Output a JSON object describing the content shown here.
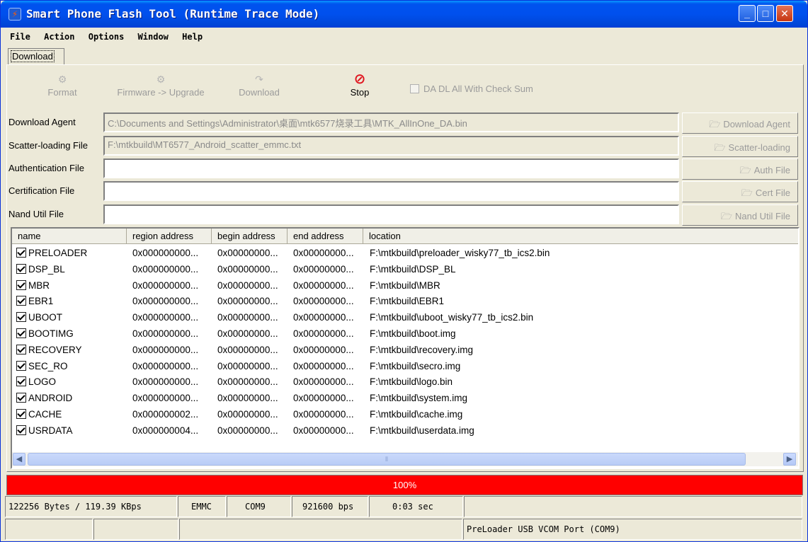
{
  "window": {
    "title": "Smart Phone Flash Tool (Runtime Trace Mode)",
    "icon": "flash-tool-app-icon",
    "controls": [
      "minimize",
      "maximize",
      "close"
    ]
  },
  "menu": [
    {
      "label": "File"
    },
    {
      "label": "Action"
    },
    {
      "label": "Options"
    },
    {
      "label": "Window"
    },
    {
      "label": "Help"
    }
  ],
  "tab": {
    "label": "Download"
  },
  "toolbar": {
    "format": "Format",
    "firmware_upgrade": "Firmware -> Upgrade",
    "download": "Download",
    "stop": "Stop",
    "checksum": "DA DL All With Check Sum"
  },
  "files": [
    {
      "label": "Download Agent",
      "value": "C:\\Documents and Settings\\Administrator\\桌面\\mtk6577烧录工具\\MTK_AllInOne_DA.bin",
      "button": "Download Agent",
      "disabled": true
    },
    {
      "label": "Scatter-loading File",
      "value": "F:\\mtkbuild\\MT6577_Android_scatter_emmc.txt",
      "button": "Scatter-loading",
      "disabled": true
    },
    {
      "label": "Authentication File",
      "value": "",
      "button": "Auth File",
      "disabled": false
    },
    {
      "label": "Certification File",
      "value": "",
      "button": "Cert File",
      "disabled": false
    },
    {
      "label": "Nand Util File",
      "value": "",
      "button": "Nand Util File",
      "disabled": false
    }
  ],
  "table": {
    "columns": [
      "name",
      "region address",
      "begin address",
      "end address",
      "location"
    ],
    "rows": [
      {
        "checked": true,
        "name": "PRELOADER",
        "region": "0x000000000...",
        "begin": "0x00000000...",
        "end": "0x00000000...",
        "location": "F:\\mtkbuild\\preloader_wisky77_tb_ics2.bin"
      },
      {
        "checked": true,
        "name": "DSP_BL",
        "region": "0x000000000...",
        "begin": "0x00000000...",
        "end": "0x00000000...",
        "location": "F:\\mtkbuild\\DSP_BL"
      },
      {
        "checked": true,
        "name": "MBR",
        "region": "0x000000000...",
        "begin": "0x00000000...",
        "end": "0x00000000...",
        "location": "F:\\mtkbuild\\MBR"
      },
      {
        "checked": true,
        "name": "EBR1",
        "region": "0x000000000...",
        "begin": "0x00000000...",
        "end": "0x00000000...",
        "location": "F:\\mtkbuild\\EBR1"
      },
      {
        "checked": true,
        "name": "UBOOT",
        "region": "0x000000000...",
        "begin": "0x00000000...",
        "end": "0x00000000...",
        "location": "F:\\mtkbuild\\uboot_wisky77_tb_ics2.bin"
      },
      {
        "checked": true,
        "name": "BOOTIMG",
        "region": "0x000000000...",
        "begin": "0x00000000...",
        "end": "0x00000000...",
        "location": "F:\\mtkbuild\\boot.img"
      },
      {
        "checked": true,
        "name": "RECOVERY",
        "region": "0x000000000...",
        "begin": "0x00000000...",
        "end": "0x00000000...",
        "location": "F:\\mtkbuild\\recovery.img"
      },
      {
        "checked": true,
        "name": "SEC_RO",
        "region": "0x000000000...",
        "begin": "0x00000000...",
        "end": "0x00000000...",
        "location": "F:\\mtkbuild\\secro.img"
      },
      {
        "checked": true,
        "name": "LOGO",
        "region": "0x000000000...",
        "begin": "0x00000000...",
        "end": "0x00000000...",
        "location": "F:\\mtkbuild\\logo.bin"
      },
      {
        "checked": true,
        "name": "ANDROID",
        "region": "0x000000000...",
        "begin": "0x00000000...",
        "end": "0x00000000...",
        "location": "F:\\mtkbuild\\system.img"
      },
      {
        "checked": true,
        "name": "CACHE",
        "region": "0x000000002...",
        "begin": "0x00000000...",
        "end": "0x00000000...",
        "location": "F:\\mtkbuild\\cache.img"
      },
      {
        "checked": true,
        "name": "USRDATA",
        "region": "0x000000004...",
        "begin": "0x00000000...",
        "end": "0x00000000...",
        "location": "F:\\mtkbuild\\userdata.img"
      }
    ]
  },
  "progress": {
    "value": 1.0,
    "text": "100%",
    "color": "#ff0000"
  },
  "status": {
    "bytes": "122256 Bytes / 119.39 KBps",
    "storage": "EMMC",
    "port": "COM9",
    "baud": "921600 bps",
    "time": "0:03 sec",
    "device": "PreLoader USB VCOM Port (COM9)"
  }
}
